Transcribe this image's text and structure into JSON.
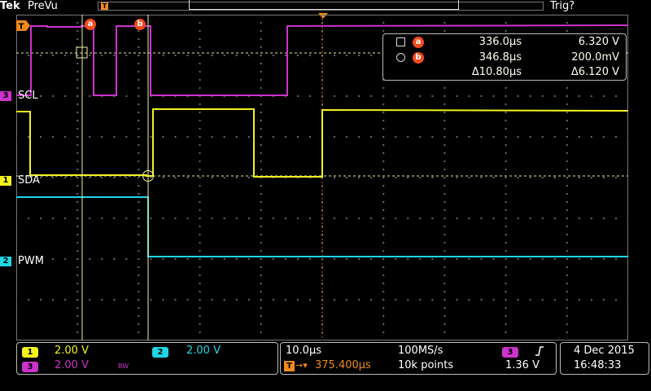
{
  "topbar": {
    "brand": "Tek",
    "status": "PreVu",
    "trigger_status": "Trig?",
    "trigger_marker": "T"
  },
  "channels": {
    "ch1": {
      "number": "1",
      "label": "SDA",
      "scale": "2.00 V",
      "color": "#f2f21e"
    },
    "ch2": {
      "number": "2",
      "label": "PWM",
      "scale": "2.00 V",
      "color": "#1ed6e6"
    },
    "ch3": {
      "number": "3",
      "label": "SCL",
      "scale": "2.00 V",
      "color": "#cc33cc",
      "bw_symbol": "BW"
    }
  },
  "cursors": {
    "a": {
      "letter": "a",
      "time": "336.0µs",
      "value": "6.320 V"
    },
    "b": {
      "letter": "b",
      "time": "346.8µs",
      "value": "200.0mV"
    },
    "delta": {
      "time": "Δ10.80µs",
      "value": "Δ6.120 V"
    }
  },
  "horizontal": {
    "time_per_div": "10.0µs",
    "sample_rate": "100MS/s",
    "record_length": "10k points",
    "position": "375.400µs"
  },
  "trigger": {
    "source": "3",
    "slope_icon": "rising-edge-icon",
    "level": "1.36 V"
  },
  "datetime": {
    "date": "4 Dec 2015",
    "time": "16:48:33"
  },
  "colors": {
    "ch1": "#f2f21e",
    "ch2": "#1ed6e6",
    "ch3": "#cc33cc",
    "cursor_marker": "#f24a1e",
    "trigger": "#f08a1c"
  }
}
